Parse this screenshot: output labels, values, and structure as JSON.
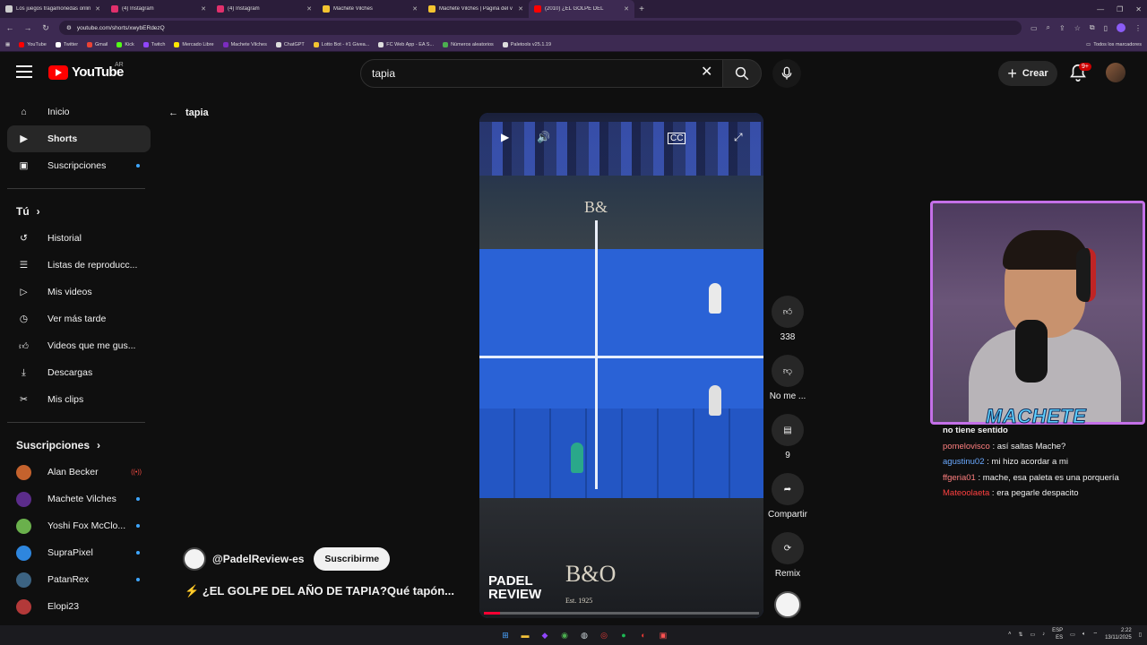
{
  "browser": {
    "tabs": [
      {
        "title": "Los juegos tragamonedas onlin",
        "color": "#cccccc"
      },
      {
        "title": "(4) Instagram",
        "color": "#e1306c"
      },
      {
        "title": "(4) Instagram",
        "color": "#e1306c"
      },
      {
        "title": "Machete Vilches",
        "color": "#f4c430"
      },
      {
        "title": "Machete Vilches | Página del v",
        "color": "#f4c430"
      },
      {
        "title": "(2010) ¿EL GOLPE DEL",
        "color": "#ff0000"
      }
    ],
    "url": "youtube.com/shorts/xwybERdezQ",
    "bookmarks": [
      {
        "label": "YouTube",
        "color": "#ff0000"
      },
      {
        "label": "Twitter",
        "color": "#ffffff"
      },
      {
        "label": "Gmail",
        "color": "#ea4335"
      },
      {
        "label": "Kick",
        "color": "#53fc18"
      },
      {
        "label": "Twitch",
        "color": "#9146ff"
      },
      {
        "label": "Mercado Libre",
        "color": "#ffe600"
      },
      {
        "label": "Machete Vilches",
        "color": "#7b2cbf"
      },
      {
        "label": "ChatGPT",
        "color": "#dddddd"
      },
      {
        "label": "Lotto Bot - #1 Givea...",
        "color": "#f4c430"
      },
      {
        "label": "FC Web App - EA S...",
        "color": "#dddddd"
      },
      {
        "label": "Números aleatorios",
        "color": "#4caf50"
      },
      {
        "label": "Paletools v25.1.19",
        "color": "#dddddd"
      }
    ],
    "all_bookmarks": "Todos los marcadores"
  },
  "youtube": {
    "logo_text": "YouTube",
    "country": "AR",
    "search_value": "tapia",
    "create_label": "Crear",
    "notif_badge": "9+",
    "back_label": "tapia",
    "nav": [
      {
        "label": "Inicio",
        "icon": "home-icon"
      },
      {
        "label": "Shorts",
        "icon": "shorts-icon"
      },
      {
        "label": "Suscripciones",
        "icon": "subscriptions-icon"
      }
    ],
    "you_header": "Tú",
    "you_items": [
      {
        "label": "Historial",
        "icon": "history-icon"
      },
      {
        "label": "Listas de reproducc...",
        "icon": "playlists-icon"
      },
      {
        "label": "Mis videos",
        "icon": "my-videos-icon"
      },
      {
        "label": "Ver más tarde",
        "icon": "watch-later-icon"
      },
      {
        "label": "Videos que me gus...",
        "icon": "liked-icon"
      },
      {
        "label": "Descargas",
        "icon": "downloads-icon"
      },
      {
        "label": "Mis clips",
        "icon": "clips-icon"
      }
    ],
    "subs_header": "Suscripciones",
    "subs": [
      {
        "label": "Alan Becker",
        "color": "#c4622d",
        "status": "live"
      },
      {
        "label": "Machete Vilches",
        "color": "#5b2c8a",
        "status": "dot"
      },
      {
        "label": "Yoshi Fox McClo...",
        "color": "#6ab04c",
        "status": "dot"
      },
      {
        "label": "SupraPixel",
        "color": "#2e86de",
        "status": "dot"
      },
      {
        "label": "PatanRex",
        "color": "#3c6382",
        "status": "dot"
      },
      {
        "label": "Elopi23",
        "color": "#b33939",
        "status": "none"
      }
    ],
    "short": {
      "channel": "@PadelReview-es",
      "subscribe": "Suscribirme",
      "title": "¿EL GOLPE DEL AÑO DE TAPIA?Qué tapón...",
      "progress": 0.06,
      "watermark_padel": "PADEL",
      "watermark_review": "REVIEW",
      "watermark_bo": "B&O",
      "watermark_est": "Est. 1925"
    },
    "actions": {
      "like_count": "338",
      "dislike_label": "No me ...",
      "comments_count": "9",
      "share_label": "Compartir",
      "remix_label": "Remix"
    }
  },
  "overlay": {
    "streamer_name": "MACHETE",
    "chat": [
      {
        "user": "",
        "text": "no tiene sentido",
        "color": "#ffffff"
      },
      {
        "user": "pomelovisco",
        "text": "así saltas Mache?",
        "color": "#ff7f7f"
      },
      {
        "user": "agustinu02",
        "text": "mi hizo acordar a mi",
        "color": "#6aa9ff"
      },
      {
        "user": "ffgeria01",
        "text": "mache, esa paleta es una porquería",
        "color": "#ff7f7f"
      },
      {
        "user": "Mateoolaeta",
        "text": "era pegarle despacito",
        "color": "#ff4040"
      }
    ]
  },
  "taskbar": {
    "lang": "ESP",
    "lang_sub": "ES",
    "time": "2:22",
    "date": "13/11/2025"
  }
}
